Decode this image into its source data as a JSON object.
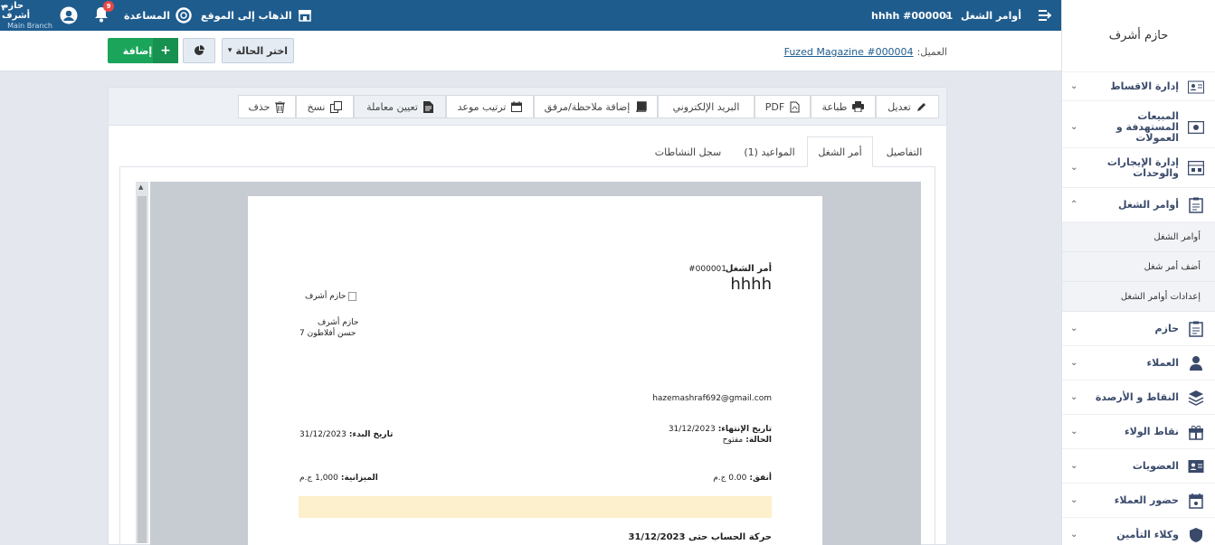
{
  "topbar": {
    "breadcrumb_parent": "أوامر الشغل",
    "breadcrumb_current": "hhhh #000001",
    "visit_site": "الذهاب إلى الموقع",
    "help": "المساعدة",
    "notifications_count": "9",
    "user_name": "حازم أشرف",
    "branch": "Main Branch"
  },
  "subbar": {
    "client_label": "العميل:",
    "client_link": "Fuzed Magazine #000004",
    "status_select": "اختر الحالة",
    "add_label": "إضافة"
  },
  "toolbar": {
    "edit": "تعديل",
    "print": "طباعة",
    "pdf": "PDF",
    "email": "البريد الإلكتروني",
    "add_note": "إضافة ملاحظة/مرفق",
    "schedule": "ترتيب موعد",
    "assign": "تعيين معاملة",
    "copy": "نسخ",
    "delete": "حذف"
  },
  "tabs": {
    "details": "التفاصيل",
    "work_order": "أمر الشغل",
    "appointments": "المواعيد (1)",
    "activity_log": "سجل النشاطات"
  },
  "document": {
    "title_label": "أمر الشغل",
    "number": "#000001",
    "name": "hhhh",
    "logo_alt": "حازم أشرف",
    "company_name": "حازم أشرف",
    "address": "7 حسن أفلاطون",
    "email": "hazemashraf692@gmail.com",
    "end_date_label": "تاريخ الإنتهاء:",
    "end_date": "31/12/2023",
    "status_label": "الحالة:",
    "status": "مفتوح",
    "start_date_label": "تاريخ البدء:",
    "start_date": "31/12/2023",
    "spent_label": "أنفق:",
    "spent": "0.00 ج.م",
    "budget_label": "الميزانية:",
    "budget": "1,000 ج.م",
    "account_movement": "حركة الحساب حتى 31/12/2023"
  },
  "sidebar": {
    "user": "حازم أشرف",
    "items": [
      {
        "label": "إدارة الاقساط",
        "icon": "installments-icon"
      },
      {
        "label": "المبيعات المستهدفة و العمولات",
        "icon": "money-icon"
      },
      {
        "label": "إدارة الإيجارات والوحدات",
        "icon": "rental-icon"
      },
      {
        "label": "أوامر الشغل",
        "icon": "clipboard-icon"
      },
      {
        "label": "حازم",
        "icon": "clipboard-icon"
      },
      {
        "label": "العملاء",
        "icon": "clients-icon"
      },
      {
        "label": "النقاط و الأرصدة",
        "icon": "layers-icon"
      },
      {
        "label": "نقاط الولاء",
        "icon": "gift-icon"
      },
      {
        "label": "العضويات",
        "icon": "id-card-icon"
      },
      {
        "label": "حضور العملاء",
        "icon": "calendar-icon"
      },
      {
        "label": "وكلاء التأمين",
        "icon": "shield-icon"
      }
    ],
    "sub_items": [
      "أوامر الشغل",
      "أضف أمر شغل",
      "إعدادات أوامر الشغل"
    ]
  },
  "colors": {
    "topbar": "#1f5c8e",
    "add_button": "#1aa55b",
    "nav_text": "#3a4a6b",
    "highlight": "#fdf0cc"
  }
}
